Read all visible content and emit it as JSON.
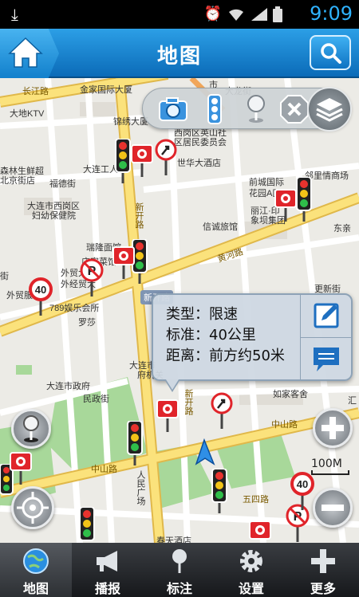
{
  "status_bar": {
    "time": "9:09"
  },
  "header": {
    "title": "地图"
  },
  "map_labels": [
    {
      "text": "长江路",
      "kind": "road"
    },
    {
      "text": "金家国际大厦",
      "kind": "poi"
    },
    {
      "text": "市",
      "kind": "poi"
    },
    {
      "text": "大龙街",
      "kind": "poi"
    },
    {
      "text": "大地KTV",
      "kind": "poi"
    },
    {
      "text": "锦绣大厦",
      "kind": "poi"
    },
    {
      "text": "西岗区英山社",
      "kind": "poi"
    },
    {
      "text": "区居民委员会",
      "kind": "poi"
    },
    {
      "text": "森林生鲜超",
      "kind": "poi"
    },
    {
      "text": "北京街店",
      "kind": "poi"
    },
    {
      "text": "福德街",
      "kind": "poi"
    },
    {
      "text": "大连工人",
      "kind": "poi"
    },
    {
      "text": "世华大酒店",
      "kind": "poi"
    },
    {
      "text": "前城国际",
      "kind": "poi"
    },
    {
      "text": "花园A区",
      "kind": "poi"
    },
    {
      "text": "邻里情商场",
      "kind": "poi"
    },
    {
      "text": "大连市西岗区",
      "kind": "poi"
    },
    {
      "text": "妇幼保健院",
      "kind": "poi"
    },
    {
      "text": "新开路",
      "kind": "road"
    },
    {
      "text": "丽江·印",
      "kind": "poi"
    },
    {
      "text": "象坝集团",
      "kind": "poi"
    },
    {
      "text": "信诚旅馆",
      "kind": "poi"
    },
    {
      "text": "东亲",
      "kind": "poi"
    },
    {
      "text": "瑞隆面馆",
      "kind": "poi"
    },
    {
      "text": "庄家菜馆",
      "kind": "poi"
    },
    {
      "text": "黄河路",
      "kind": "road"
    },
    {
      "text": "外贸大",
      "kind": "poi"
    },
    {
      "text": "外经贸大",
      "kind": "poi"
    },
    {
      "text": "新开路",
      "kind": "road"
    },
    {
      "text": "更新街",
      "kind": "poi"
    },
    {
      "text": "外贸服",
      "kind": "poi"
    },
    {
      "text": "789娱乐会所",
      "kind": "poi"
    },
    {
      "text": "罗莎",
      "kind": "poi"
    },
    {
      "text": "大连市",
      "kind": "poi"
    },
    {
      "text": "府机关",
      "kind": "poi"
    },
    {
      "text": "大连市政府",
      "kind": "poi"
    },
    {
      "text": "民政街",
      "kind": "poi"
    },
    {
      "text": "新开路",
      "kind": "road"
    },
    {
      "text": "如家客舍",
      "kind": "poi"
    },
    {
      "text": "汇",
      "kind": "poi"
    },
    {
      "text": "中山路",
      "kind": "road"
    },
    {
      "text": "中山路",
      "kind": "road"
    },
    {
      "text": "人民广场",
      "kind": "poi"
    },
    {
      "text": "五四路",
      "kind": "road"
    },
    {
      "text": "春天酒店",
      "kind": "poi"
    },
    {
      "text": "街",
      "kind": "poi"
    }
  ],
  "toolbar": {
    "buttons": [
      {
        "icon": "camera-icon"
      },
      {
        "icon": "traffic-light-icon"
      },
      {
        "icon": "pin-icon"
      },
      {
        "icon": "close-icon"
      },
      {
        "icon": "layers-icon"
      }
    ]
  },
  "popup": {
    "type_line": "类型：限速",
    "standard_line": "标准：40公里",
    "distance_line": "距离：前方约50米"
  },
  "speed_limit_value": "40",
  "scale": {
    "label": "100M"
  },
  "nav": {
    "items": [
      {
        "label": "地图",
        "icon": "globe-icon",
        "active": true
      },
      {
        "label": "播报",
        "icon": "megaphone-icon",
        "active": false
      },
      {
        "label": "标注",
        "icon": "pin-icon",
        "active": false
      },
      {
        "label": "设置",
        "icon": "gear-icon",
        "active": false
      },
      {
        "label": "更多",
        "icon": "plus-icon",
        "active": false
      }
    ]
  },
  "colors": {
    "header": "#1a86d4",
    "major_road": "#fbe27c",
    "park": "#a8d89a",
    "time": "#2fb3ff"
  }
}
